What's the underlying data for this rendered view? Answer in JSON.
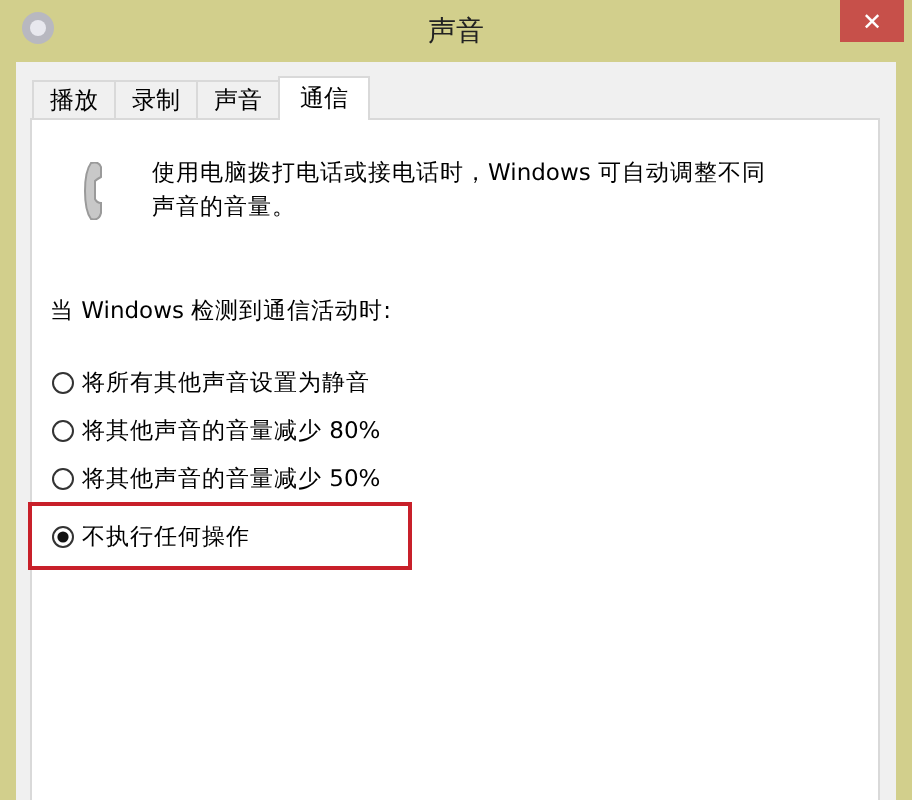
{
  "window": {
    "title": "声音",
    "close": "✕"
  },
  "tabs": [
    {
      "label": "播放",
      "selected": false
    },
    {
      "label": "录制",
      "selected": false
    },
    {
      "label": "声音",
      "selected": false
    },
    {
      "label": "通信",
      "selected": true
    }
  ],
  "description": "使用电脑拨打电话或接电话时，Windows 可自动调整不同声音的音量。",
  "prompt": "当 Windows 检测到通信活动时:",
  "options": [
    {
      "label": "将所有其他声音设置为静音",
      "selected": false,
      "highlighted": false
    },
    {
      "label": "将其他声音的音量减少 80%",
      "selected": false,
      "highlighted": false
    },
    {
      "label": "将其他声音的音量减少 50%",
      "selected": false,
      "highlighted": false
    },
    {
      "label": "不执行任何操作",
      "selected": true,
      "highlighted": true
    }
  ]
}
